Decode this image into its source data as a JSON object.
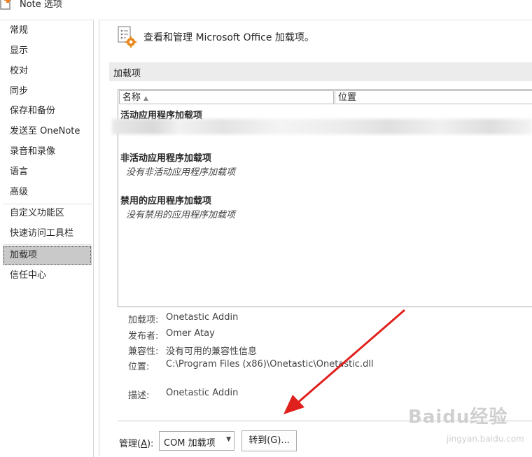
{
  "window": {
    "title": "Note 选项"
  },
  "sidebar": {
    "items": [
      {
        "label": "常规"
      },
      {
        "label": "显示"
      },
      {
        "label": "校对"
      },
      {
        "label": "同步"
      },
      {
        "label": "保存和备份"
      },
      {
        "label": "发送至 OneNote"
      },
      {
        "label": "录音和录像"
      },
      {
        "label": "语言"
      },
      {
        "label": "高级"
      },
      {
        "label": "自定义功能区"
      },
      {
        "label": "快速访问工具栏"
      },
      {
        "label": "加载项"
      },
      {
        "label": "信任中心"
      }
    ],
    "active_index": 11
  },
  "header": {
    "text": "查看和管理 Microsoft Office 加载项。"
  },
  "section": {
    "label": "加载项"
  },
  "table": {
    "columns": [
      "名称",
      "位置"
    ],
    "groups": [
      {
        "heading": "活动应用程序加载项",
        "empty_text": ""
      },
      {
        "heading": "非活动应用程序加载项",
        "empty_text": "没有非活动应用程序加载项"
      },
      {
        "heading": "禁用的应用程序加载项",
        "empty_text": "没有禁用的应用程序加载项"
      }
    ]
  },
  "details": {
    "addin_label": "加载项:",
    "addin_value": "Onetastic Addin",
    "publisher_label": "发布者:",
    "publisher_value": "Omer Atay",
    "compat_label": "兼容性:",
    "compat_value": "没有可用的兼容性信息",
    "location_label": "位置:",
    "location_value": "C:\\Program Files (x86)\\Onetastic\\Onetastic.dll",
    "desc_label": "描述:",
    "desc_value": "Onetastic Addin"
  },
  "manage": {
    "label": "管理(",
    "label_key": "A",
    "label_end": "):",
    "selected": "COM 加载项",
    "goto_label": "转到(G)..."
  },
  "watermark": {
    "brand": "Baidu经验",
    "url": "jingyan.baidu.com"
  },
  "colors": {
    "annotation_arrow": "#e0201c",
    "active_item_bg": "#c9c9c9",
    "section_bar": "#ececec"
  }
}
